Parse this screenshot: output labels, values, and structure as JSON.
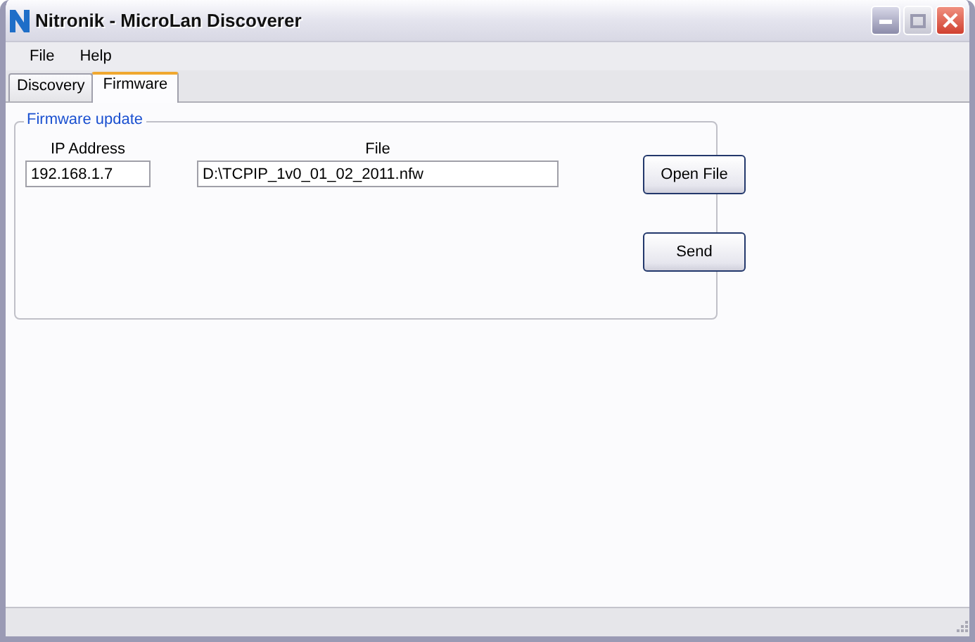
{
  "window": {
    "title": "Nitronik - MicroLan Discoverer"
  },
  "menu": [
    "File",
    "Help"
  ],
  "tabs": [
    {
      "label": "Discovery",
      "selected": false
    },
    {
      "label": "Firmware",
      "selected": true
    }
  ],
  "group": {
    "title": "Firmware update",
    "ip": {
      "label": "IP Address",
      "value": "192.168.1.7"
    },
    "file": {
      "label": "File",
      "value": "D:\\TCPIP_1v0_01_02_2011.nfw"
    },
    "buttons": [
      "Open File",
      "Send"
    ]
  }
}
